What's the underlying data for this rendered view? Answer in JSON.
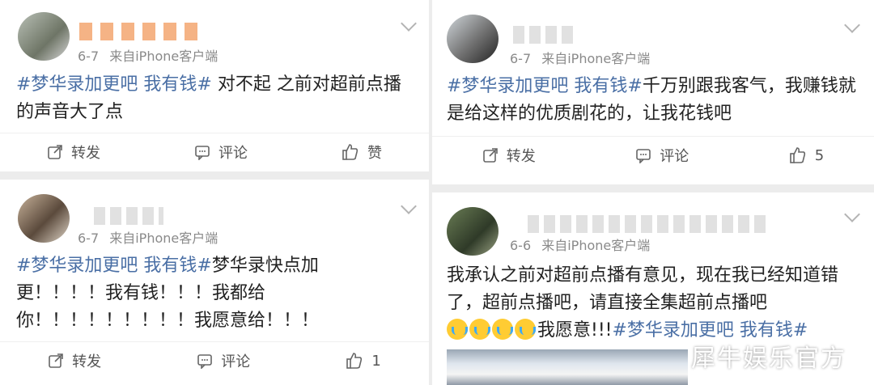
{
  "posts": [
    {
      "meta": {
        "date": "6-7",
        "source": "来自iPhone客户端"
      },
      "text": {
        "tag": "#梦华录加更吧 我有钱#",
        "body": " 对不起 之前对超前点播的声音大了点"
      },
      "actions": {
        "repost": "转发",
        "comment": "评论",
        "like": "赞"
      }
    },
    {
      "meta": {
        "date": "6-7",
        "source": "来自iPhone客户端"
      },
      "text": {
        "tag": "#梦华录加更吧 我有钱#",
        "body": "千万别跟我客气，我赚钱就是给这样的优质剧花的，让我花钱吧"
      },
      "actions": {
        "repost": "转发",
        "comment": "评论",
        "like_count": "5"
      }
    },
    {
      "meta": {
        "date": "6-7",
        "source": "来自iPhone客户端"
      },
      "text": {
        "tag": "#梦华录加更吧 我有钱#",
        "body": "梦华录快点加更！！！！我有钱！！！我都给你！！！！！！！！！我愿意给！！！"
      },
      "actions": {
        "repost": "转发",
        "comment": "评论",
        "like_count": "1"
      }
    },
    {
      "meta": {
        "date": "6-6",
        "source": "来自iPhone客户端"
      },
      "text": {
        "body": "我承认之前对超前点播有意见，现在我已经知道错了，超前点播吧，请直接全集超前点播吧",
        "tail": "我愿意!!!",
        "tag": "#梦华录加更吧 我有钱#"
      }
    }
  ],
  "watermark": "犀牛娱乐官方",
  "colors": {
    "tag": "#4a6fa5",
    "background": "#ececec"
  }
}
